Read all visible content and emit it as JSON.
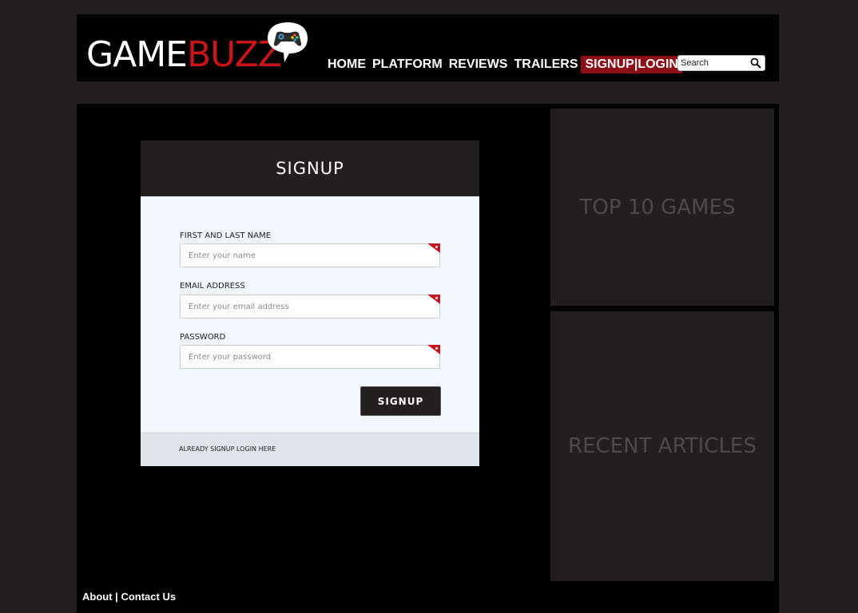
{
  "header": {
    "logo_part1": "GAME",
    "logo_part2": "BUZZ",
    "logo_icon": "speech-bubble-gamepad-icon",
    "nav": {
      "home": "HOME",
      "platform": "PLATFORM",
      "reviews": "REVIEWS",
      "trailers": "TRAILERS",
      "signup_login": "SIGNUP|LOGIN"
    },
    "search_placeholder": "Search",
    "search_icon": "magnifier-icon"
  },
  "signup_form": {
    "title": "SIGNUP",
    "name_label": "FIRST AND LAST NAME",
    "name_placeholder": "Enter your name",
    "email_label": "EMAIL ADDRESS",
    "email_placeholder": "Enter your email address",
    "password_label": "PASSWORD",
    "password_placeholder": "Enter your password",
    "submit_label": "SIGNUP",
    "footer_link": "ALREADY SIGNUP LOGIN HERE"
  },
  "sidebar": {
    "top_games_title": "TOP 10 GAMES",
    "recent_articles_title": "RECENT ARTICLES"
  },
  "footer": {
    "about": "About",
    "separator": "|",
    "contact": "Contact Us"
  },
  "colors": {
    "page_bg": "#231f20",
    "brand_red": "#c8141b",
    "active_nav": "#8b0f14",
    "panel_bg": "#000000"
  }
}
